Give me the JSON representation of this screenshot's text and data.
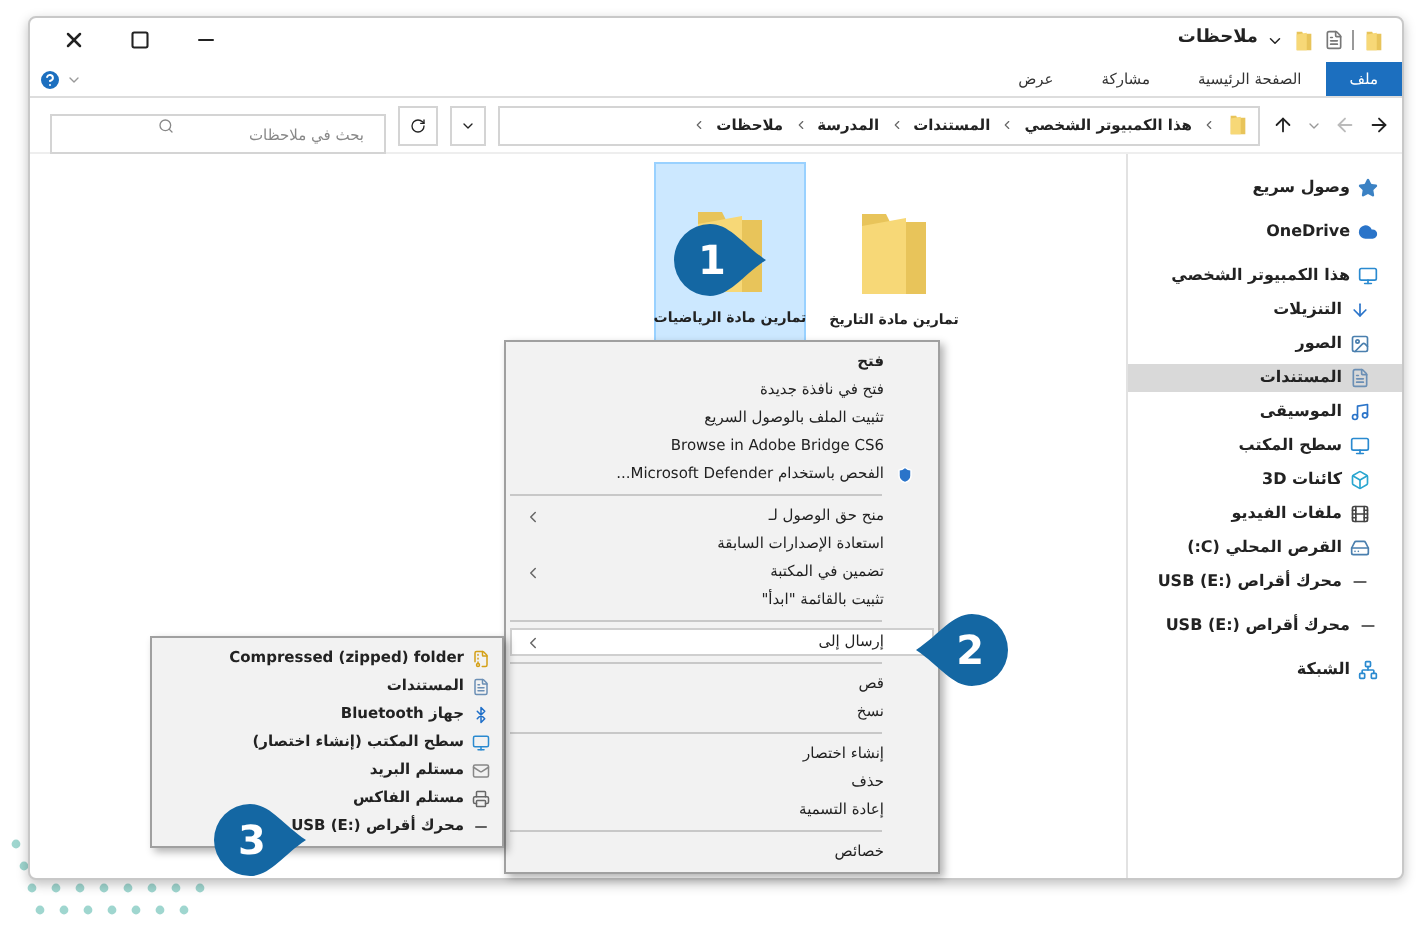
{
  "window": {
    "title": "ملاحظات"
  },
  "ribbon_tabs": [
    {
      "label": "ملف",
      "selected": true
    },
    {
      "label": "الصفحة الرئيسية",
      "selected": false
    },
    {
      "label": "مشاركة",
      "selected": false
    },
    {
      "label": "عرض",
      "selected": false
    }
  ],
  "address_bar": {
    "path": [
      "هذا الكمبيوتر الشخصي",
      "المستندات",
      "المدرسة",
      "ملاحظات"
    ]
  },
  "search": {
    "placeholder": "بحث في ملاحظات"
  },
  "sidebar": {
    "sections": [
      {
        "items": [
          {
            "label": "وصول سريع",
            "selected": false
          }
        ]
      },
      {
        "items": [
          {
            "label": "OneDrive",
            "selected": false
          }
        ]
      },
      {
        "items": [
          {
            "label": "هذا الكمبيوتر الشخصي",
            "selected": false,
            "children": [
              {
                "label": "التنزيلات",
                "selected": false
              },
              {
                "label": "الصور",
                "selected": false
              },
              {
                "label": "المستندات",
                "selected": true
              },
              {
                "label": "الموسيقى",
                "selected": false
              },
              {
                "label": "سطح المكتب",
                "selected": false
              },
              {
                "label": "كائنات 3D",
                "selected": false
              },
              {
                "label": "ملفات الفيديو",
                "selected": false
              },
              {
                "label": "القرص المحلي (C:)",
                "selected": false
              },
              {
                "label": "محرك أقراص USB (E:)",
                "selected": false
              }
            ]
          }
        ]
      },
      {
        "items": [
          {
            "label": "محرك أقراص USB (E:)",
            "selected": false
          }
        ]
      },
      {
        "items": [
          {
            "label": "الشبكة",
            "selected": false
          }
        ]
      }
    ]
  },
  "folders": [
    {
      "name": "تمارين مادة التاريخ",
      "selected": false
    },
    {
      "name": "تمارين مادة الرياضيات",
      "selected": true
    }
  ],
  "context_menu": {
    "groups": [
      {
        "items": [
          {
            "label": "فتح",
            "default": true,
            "submenu": false,
            "selected": false
          },
          {
            "label": "فتح في نافذة جديدة",
            "default": false,
            "submenu": false,
            "selected": false
          },
          {
            "label": "تثبيت الملف بالوصول السريع",
            "default": false,
            "submenu": false,
            "selected": false
          },
          {
            "label": "Browse in Adobe Bridge CS6",
            "default": false,
            "submenu": false,
            "selected": false
          },
          {
            "label": "الفحص باستخدام Microsoft Defender...",
            "default": false,
            "submenu": false,
            "selected": false
          }
        ]
      },
      {
        "items": [
          {
            "label": "منح حق الوصول لـ",
            "default": false,
            "submenu": true,
            "selected": false
          },
          {
            "label": "استعادة الإصدارات السابقة",
            "default": false,
            "submenu": false,
            "selected": false
          },
          {
            "label": "تضمين في المكتبة",
            "default": false,
            "submenu": true,
            "selected": false
          },
          {
            "label": "تثبيت بالقائمة \"ابدأ\"",
            "default": false,
            "submenu": false,
            "selected": false
          }
        ]
      },
      {
        "items": [
          {
            "label": "إرسال إلى",
            "default": false,
            "submenu": true,
            "selected": true
          }
        ]
      },
      {
        "items": [
          {
            "label": "قص",
            "default": false,
            "submenu": false,
            "selected": false
          },
          {
            "label": "نسخ",
            "default": false,
            "submenu": false,
            "selected": false
          }
        ]
      },
      {
        "items": [
          {
            "label": "إنشاء اختصار",
            "default": false,
            "submenu": false,
            "selected": false
          },
          {
            "label": "حذف",
            "default": false,
            "submenu": false,
            "selected": false
          },
          {
            "label": "إعادة التسمية",
            "default": false,
            "submenu": false,
            "selected": false
          }
        ]
      },
      {
        "items": [
          {
            "label": "خصائص",
            "default": false,
            "submenu": false,
            "selected": false
          }
        ]
      }
    ]
  },
  "send_to_menu": {
    "items": [
      {
        "label": "Compressed (zipped) folder"
      },
      {
        "label": "المستندات"
      },
      {
        "label": "جهاز Bluetooth"
      },
      {
        "label": "سطح المكتب (إنشاء اختصار)"
      },
      {
        "label": "مستلم البريد"
      },
      {
        "label": "مستلم الفاكس"
      },
      {
        "label": "محرك أقراص USB (E:)"
      }
    ]
  },
  "callouts": [
    {
      "number": "1"
    },
    {
      "number": "2"
    },
    {
      "number": "3"
    }
  ]
}
